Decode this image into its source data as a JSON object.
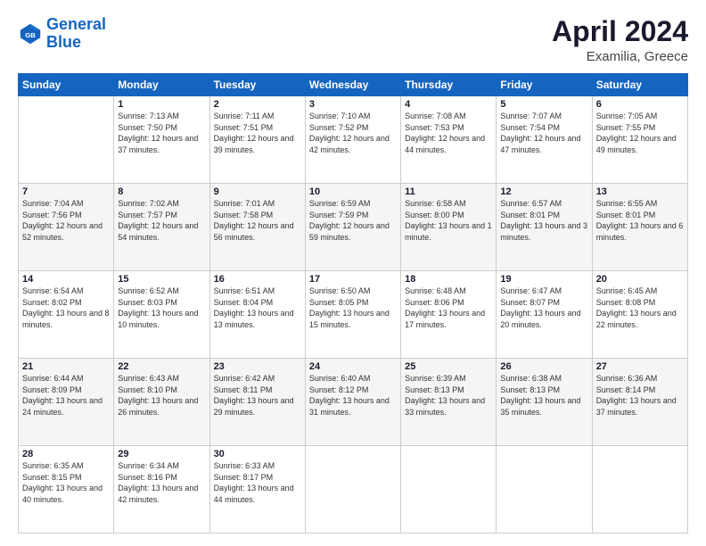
{
  "logo": {
    "line1": "General",
    "line2": "Blue"
  },
  "header": {
    "title": "April 2024",
    "subtitle": "Examilia, Greece"
  },
  "weekdays": [
    "Sunday",
    "Monday",
    "Tuesday",
    "Wednesday",
    "Thursday",
    "Friday",
    "Saturday"
  ],
  "weeks": [
    [
      {
        "day": "",
        "sunrise": "",
        "sunset": "",
        "daylight": ""
      },
      {
        "day": "1",
        "sunrise": "Sunrise: 7:13 AM",
        "sunset": "Sunset: 7:50 PM",
        "daylight": "Daylight: 12 hours and 37 minutes."
      },
      {
        "day": "2",
        "sunrise": "Sunrise: 7:11 AM",
        "sunset": "Sunset: 7:51 PM",
        "daylight": "Daylight: 12 hours and 39 minutes."
      },
      {
        "day": "3",
        "sunrise": "Sunrise: 7:10 AM",
        "sunset": "Sunset: 7:52 PM",
        "daylight": "Daylight: 12 hours and 42 minutes."
      },
      {
        "day": "4",
        "sunrise": "Sunrise: 7:08 AM",
        "sunset": "Sunset: 7:53 PM",
        "daylight": "Daylight: 12 hours and 44 minutes."
      },
      {
        "day": "5",
        "sunrise": "Sunrise: 7:07 AM",
        "sunset": "Sunset: 7:54 PM",
        "daylight": "Daylight: 12 hours and 47 minutes."
      },
      {
        "day": "6",
        "sunrise": "Sunrise: 7:05 AM",
        "sunset": "Sunset: 7:55 PM",
        "daylight": "Daylight: 12 hours and 49 minutes."
      }
    ],
    [
      {
        "day": "7",
        "sunrise": "Sunrise: 7:04 AM",
        "sunset": "Sunset: 7:56 PM",
        "daylight": "Daylight: 12 hours and 52 minutes."
      },
      {
        "day": "8",
        "sunrise": "Sunrise: 7:02 AM",
        "sunset": "Sunset: 7:57 PM",
        "daylight": "Daylight: 12 hours and 54 minutes."
      },
      {
        "day": "9",
        "sunrise": "Sunrise: 7:01 AM",
        "sunset": "Sunset: 7:58 PM",
        "daylight": "Daylight: 12 hours and 56 minutes."
      },
      {
        "day": "10",
        "sunrise": "Sunrise: 6:59 AM",
        "sunset": "Sunset: 7:59 PM",
        "daylight": "Daylight: 12 hours and 59 minutes."
      },
      {
        "day": "11",
        "sunrise": "Sunrise: 6:58 AM",
        "sunset": "Sunset: 8:00 PM",
        "daylight": "Daylight: 13 hours and 1 minute."
      },
      {
        "day": "12",
        "sunrise": "Sunrise: 6:57 AM",
        "sunset": "Sunset: 8:01 PM",
        "daylight": "Daylight: 13 hours and 3 minutes."
      },
      {
        "day": "13",
        "sunrise": "Sunrise: 6:55 AM",
        "sunset": "Sunset: 8:01 PM",
        "daylight": "Daylight: 13 hours and 6 minutes."
      }
    ],
    [
      {
        "day": "14",
        "sunrise": "Sunrise: 6:54 AM",
        "sunset": "Sunset: 8:02 PM",
        "daylight": "Daylight: 13 hours and 8 minutes."
      },
      {
        "day": "15",
        "sunrise": "Sunrise: 6:52 AM",
        "sunset": "Sunset: 8:03 PM",
        "daylight": "Daylight: 13 hours and 10 minutes."
      },
      {
        "day": "16",
        "sunrise": "Sunrise: 6:51 AM",
        "sunset": "Sunset: 8:04 PM",
        "daylight": "Daylight: 13 hours and 13 minutes."
      },
      {
        "day": "17",
        "sunrise": "Sunrise: 6:50 AM",
        "sunset": "Sunset: 8:05 PM",
        "daylight": "Daylight: 13 hours and 15 minutes."
      },
      {
        "day": "18",
        "sunrise": "Sunrise: 6:48 AM",
        "sunset": "Sunset: 8:06 PM",
        "daylight": "Daylight: 13 hours and 17 minutes."
      },
      {
        "day": "19",
        "sunrise": "Sunrise: 6:47 AM",
        "sunset": "Sunset: 8:07 PM",
        "daylight": "Daylight: 13 hours and 20 minutes."
      },
      {
        "day": "20",
        "sunrise": "Sunrise: 6:45 AM",
        "sunset": "Sunset: 8:08 PM",
        "daylight": "Daylight: 13 hours and 22 minutes."
      }
    ],
    [
      {
        "day": "21",
        "sunrise": "Sunrise: 6:44 AM",
        "sunset": "Sunset: 8:09 PM",
        "daylight": "Daylight: 13 hours and 24 minutes."
      },
      {
        "day": "22",
        "sunrise": "Sunrise: 6:43 AM",
        "sunset": "Sunset: 8:10 PM",
        "daylight": "Daylight: 13 hours and 26 minutes."
      },
      {
        "day": "23",
        "sunrise": "Sunrise: 6:42 AM",
        "sunset": "Sunset: 8:11 PM",
        "daylight": "Daylight: 13 hours and 29 minutes."
      },
      {
        "day": "24",
        "sunrise": "Sunrise: 6:40 AM",
        "sunset": "Sunset: 8:12 PM",
        "daylight": "Daylight: 13 hours and 31 minutes."
      },
      {
        "day": "25",
        "sunrise": "Sunrise: 6:39 AM",
        "sunset": "Sunset: 8:13 PM",
        "daylight": "Daylight: 13 hours and 33 minutes."
      },
      {
        "day": "26",
        "sunrise": "Sunrise: 6:38 AM",
        "sunset": "Sunset: 8:13 PM",
        "daylight": "Daylight: 13 hours and 35 minutes."
      },
      {
        "day": "27",
        "sunrise": "Sunrise: 6:36 AM",
        "sunset": "Sunset: 8:14 PM",
        "daylight": "Daylight: 13 hours and 37 minutes."
      }
    ],
    [
      {
        "day": "28",
        "sunrise": "Sunrise: 6:35 AM",
        "sunset": "Sunset: 8:15 PM",
        "daylight": "Daylight: 13 hours and 40 minutes."
      },
      {
        "day": "29",
        "sunrise": "Sunrise: 6:34 AM",
        "sunset": "Sunset: 8:16 PM",
        "daylight": "Daylight: 13 hours and 42 minutes."
      },
      {
        "day": "30",
        "sunrise": "Sunrise: 6:33 AM",
        "sunset": "Sunset: 8:17 PM",
        "daylight": "Daylight: 13 hours and 44 minutes."
      },
      {
        "day": "",
        "sunrise": "",
        "sunset": "",
        "daylight": ""
      },
      {
        "day": "",
        "sunrise": "",
        "sunset": "",
        "daylight": ""
      },
      {
        "day": "",
        "sunrise": "",
        "sunset": "",
        "daylight": ""
      },
      {
        "day": "",
        "sunrise": "",
        "sunset": "",
        "daylight": ""
      }
    ]
  ]
}
